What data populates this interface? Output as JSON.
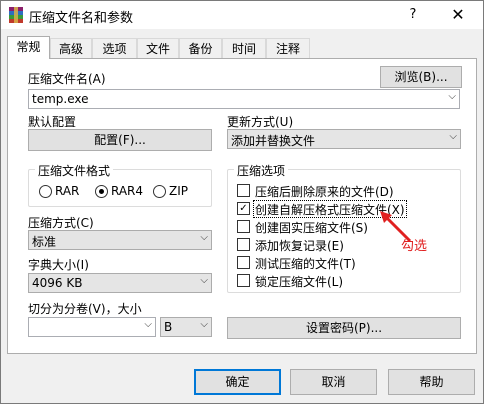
{
  "window": {
    "title": "压缩文件名和参数",
    "help_label": "?",
    "close_label": "✕"
  },
  "tabs": [
    {
      "label": "常规",
      "active": true
    },
    {
      "label": "高级"
    },
    {
      "label": "选项"
    },
    {
      "label": "文件"
    },
    {
      "label": "备份"
    },
    {
      "label": "时间"
    },
    {
      "label": "注释"
    }
  ],
  "archive_name": {
    "label": "压缩文件名(A)",
    "value": "temp.exe",
    "browse_label": "浏览(B)..."
  },
  "profile": {
    "label": "默认配置",
    "button_label": "配置(F)..."
  },
  "update_mode": {
    "label": "更新方式(U)",
    "value": "添加并替换文件"
  },
  "archive_format": {
    "title": "压缩文件格式",
    "options": [
      {
        "label": "RAR",
        "checked": false
      },
      {
        "label": "RAR4",
        "checked": true
      },
      {
        "label": "ZIP",
        "checked": false
      }
    ]
  },
  "compression_method": {
    "label": "压缩方式(C)",
    "value": "标准"
  },
  "dictionary_size": {
    "label": "字典大小(I)",
    "value": "4096 KB"
  },
  "split_volumes": {
    "label": "切分为分卷(V)，大小",
    "value": "",
    "unit": "B"
  },
  "archive_options": {
    "title": "压缩选项",
    "items": [
      {
        "label": "压缩后删除原来的文件(D)",
        "checked": false
      },
      {
        "label": "创建自解压格式压缩文件(X)",
        "checked": true
      },
      {
        "label": "创建固实压缩文件(S)",
        "checked": false
      },
      {
        "label": "添加恢复记录(E)",
        "checked": false
      },
      {
        "label": "测试压缩的文件(T)",
        "checked": false
      },
      {
        "label": "锁定压缩文件(L)",
        "checked": false
      }
    ]
  },
  "password_button_label": "设置密码(P)...",
  "annotation": {
    "text": "勾选",
    "color": "#e02020"
  },
  "buttons": {
    "ok": "确定",
    "cancel": "取消",
    "help": "帮助"
  },
  "colors": {
    "accent": "#0078d7",
    "annotation": "#e02020"
  }
}
